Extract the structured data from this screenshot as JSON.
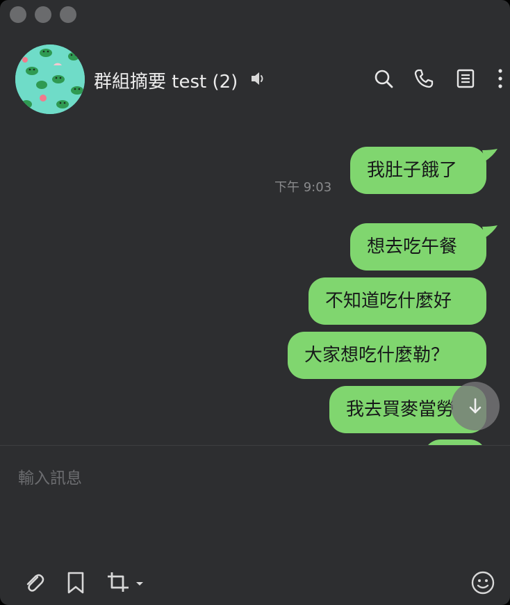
{
  "window": {
    "title": "群組摘要 test (2)"
  },
  "header": {
    "title": "群組摘要 test (2)",
    "icons": [
      "speaker-icon",
      "search-icon",
      "phone-icon",
      "notes-icon",
      "more-icon"
    ]
  },
  "messages": [
    {
      "text": "我肚子餓了",
      "time": "下午 9:03",
      "has_tail": true
    },
    {
      "text": "想去吃午餐",
      "time": "",
      "has_tail": true
    },
    {
      "text": "不知道吃什麼好",
      "time": "",
      "has_tail": false
    },
    {
      "text": "大家想吃什麼勒？",
      "time": "",
      "has_tail": false
    },
    {
      "text": "我去買麥當勞",
      "time": "",
      "has_tail": false
    }
  ],
  "composer": {
    "placeholder": "輸入訊息",
    "icons": [
      "attach-icon",
      "bookmark-icon",
      "crop-icon",
      "emoji-icon"
    ]
  },
  "colors": {
    "background": "#2d2e30",
    "bubble": "#80d66f",
    "avatar_bg": "#6fdcc8"
  }
}
